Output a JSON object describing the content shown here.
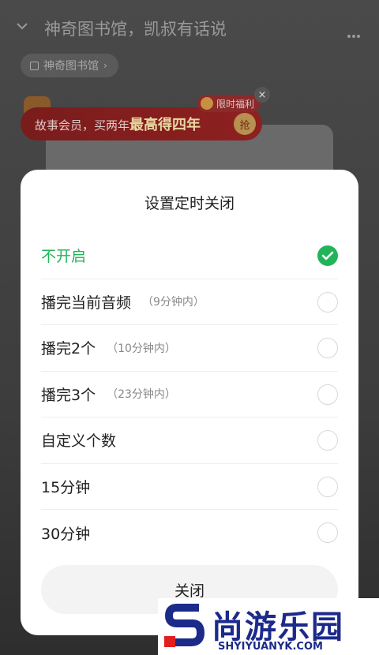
{
  "background": {
    "title": "神奇图书馆，凯叔有话说",
    "chip_label": "神奇图书馆",
    "banner_text_prefix": "故事会员，买两年",
    "banner_text_highlight": "最高得四年",
    "banner_button": "抢",
    "badge_label": "限时福利",
    "close": "×"
  },
  "sheet": {
    "title": "设置定时关闭",
    "options": [
      {
        "label": "不开启",
        "sub": "",
        "selected": true
      },
      {
        "label": "播完当前音频",
        "sub": "（9分钟内）",
        "selected": false
      },
      {
        "label": "播完2个",
        "sub": "（10分钟内）",
        "selected": false
      },
      {
        "label": "播完3个",
        "sub": "（23分钟内）",
        "selected": false
      },
      {
        "label": "自定义个数",
        "sub": "",
        "selected": false
      },
      {
        "label": "15分钟",
        "sub": "",
        "selected": false
      },
      {
        "label": "30分钟",
        "sub": "",
        "selected": false
      }
    ],
    "close_label": "关闭"
  },
  "watermark": {
    "brand": "尚游乐园",
    "url": "SHYIYUANYK.COM"
  },
  "colors": {
    "accent_green": "#22b45a",
    "watermark_blue": "#1c2a8a",
    "watermark_red": "#e02020"
  }
}
